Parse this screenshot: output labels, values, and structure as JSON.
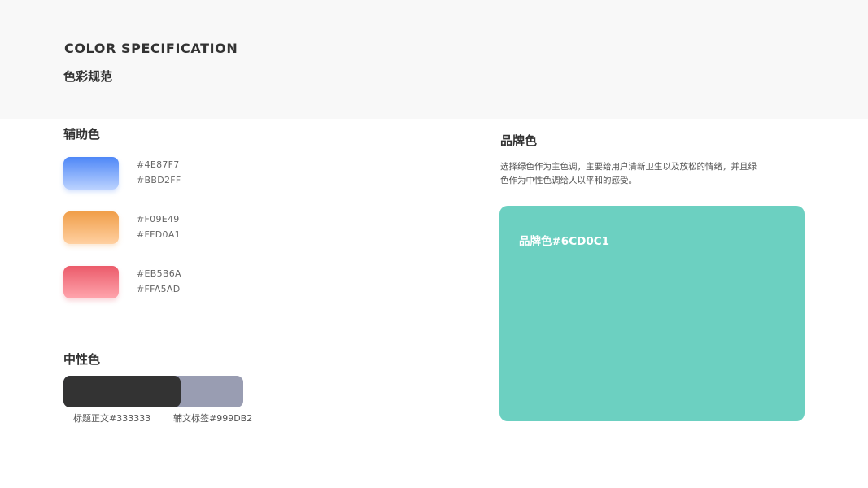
{
  "header": {
    "title_en": "COLOR SPECIFICATION",
    "title_zh": "色彩规范"
  },
  "auxiliary": {
    "title": "辅助色",
    "swatches": [
      {
        "from": "#4E87F7",
        "to": "#BBD2FF"
      },
      {
        "from": "#F09E49",
        "to": "#FFD0A1"
      },
      {
        "from": "#EB5B6A",
        "to": "#FFA5AD"
      }
    ]
  },
  "neutral": {
    "title": "中性色",
    "items": [
      {
        "label": "标题正文#333333",
        "color": "#333333"
      },
      {
        "label": "辅文标签#999DB2",
        "color": "#999DB2"
      }
    ]
  },
  "brand": {
    "title": "品牌色",
    "description": "选择绿色作为主色调，主要给用户清新卫生以及放松的情绪，并且绿色作为中性色调给人以平和的感受。",
    "card_label": "品牌色#6CD0C1",
    "color": "#6CD0C1"
  }
}
